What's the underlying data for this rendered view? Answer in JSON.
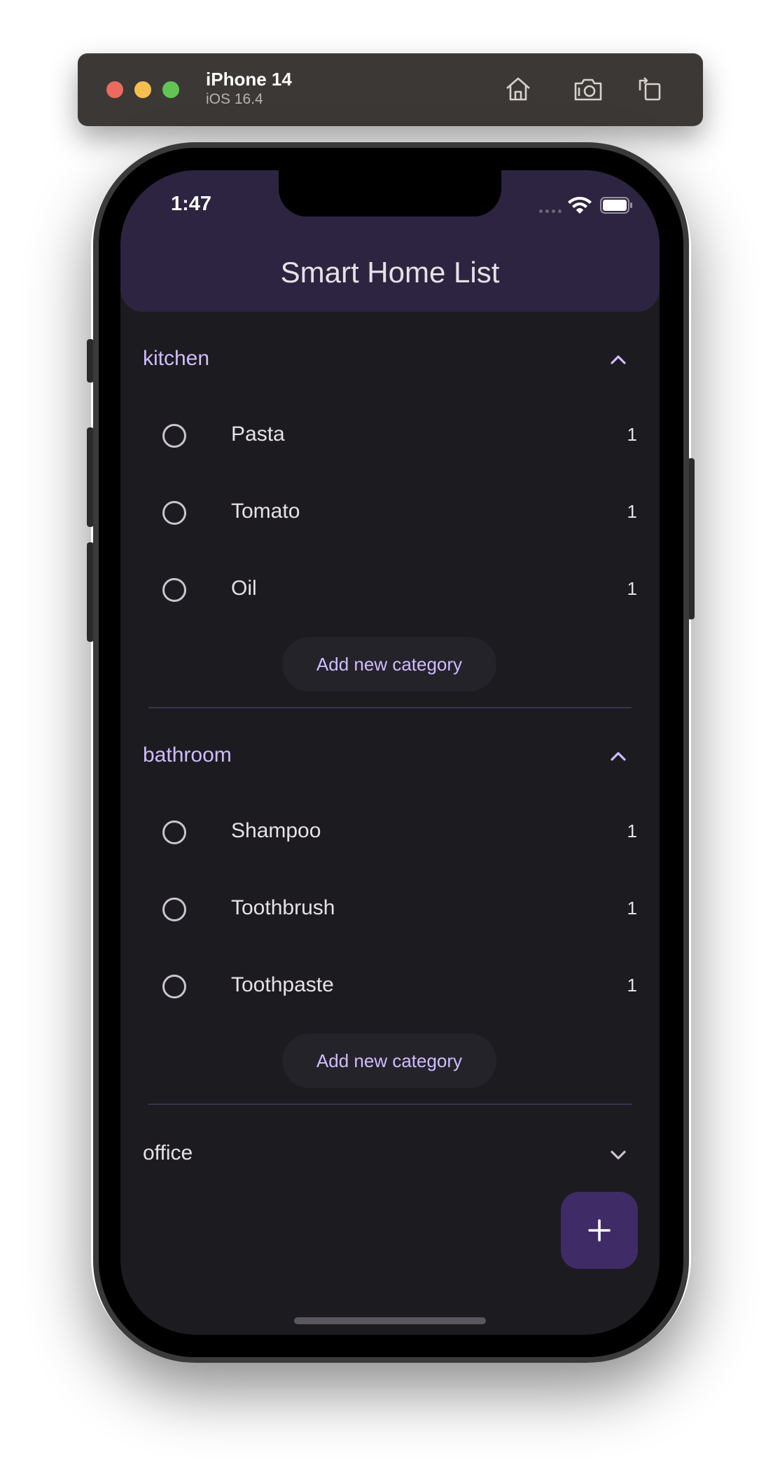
{
  "simulator": {
    "device_name": "iPhone 14",
    "os_version": "iOS 16.4",
    "buttons": {
      "home": "home-icon",
      "screenshot": "screenshot-icon",
      "rotate": "rotate-icon"
    }
  },
  "status_bar": {
    "time": "1:47"
  },
  "app": {
    "title": "Smart Home List",
    "colors": {
      "appbar": "#2c2440",
      "background": "#1c1b1f",
      "accent": "#cfbcff",
      "fab": "#3f2c66"
    }
  },
  "sections": [
    {
      "name": "kitchen",
      "expanded": true,
      "items": [
        {
          "label": "Pasta",
          "qty": "1",
          "checked": false
        },
        {
          "label": "Tomato",
          "qty": "1",
          "checked": false
        },
        {
          "label": "Oil",
          "qty": "1",
          "checked": false
        }
      ],
      "add_button_label": "Add new category"
    },
    {
      "name": "bathroom",
      "expanded": true,
      "items": [
        {
          "label": "Shampoo",
          "qty": "1",
          "checked": false
        },
        {
          "label": "Toothbrush",
          "qty": "1",
          "checked": false
        },
        {
          "label": "Toothpaste",
          "qty": "1",
          "checked": false
        }
      ],
      "add_button_label": "Add new category"
    },
    {
      "name": "office",
      "expanded": false,
      "items": []
    }
  ],
  "fab": {
    "icon": "plus-icon"
  }
}
